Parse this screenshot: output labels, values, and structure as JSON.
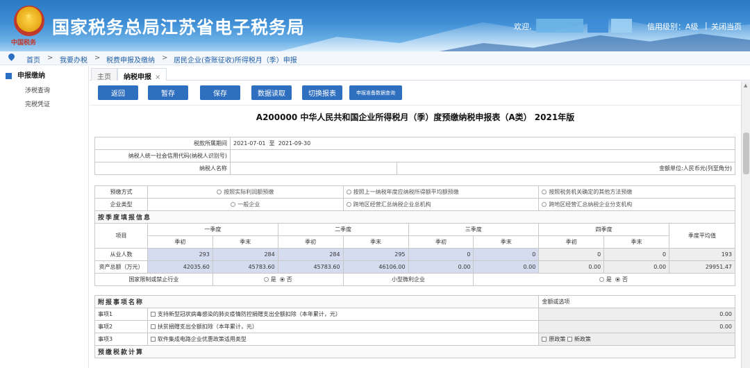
{
  "header": {
    "emblem_caption": "中国税务",
    "site_title": "国家税务总局江苏省电子税务局",
    "welcome": "欢迎,",
    "credit_level": "信用级别：A级",
    "close_label": "关闭当页"
  },
  "breadcrumb": [
    "首页",
    "我要办税",
    "税费申报及缴纳",
    "居民企业(查账征收)所得税月（季）申报"
  ],
  "sidebar": {
    "title": "申报缴纳",
    "items": [
      "涉税查询",
      "完税凭证"
    ]
  },
  "tabs": [
    {
      "label": "主页"
    },
    {
      "label": "纳税申报",
      "close": "×"
    }
  ],
  "toolbar": {
    "back": "返回",
    "draft": "暂存",
    "save": "保存",
    "read": "数据读取",
    "switch": "切换报表",
    "query": "申报准备数据查询"
  },
  "form": {
    "title": "A200000 中华人民共和国企业所得税月（季）度预缴纳税申报表（A类） 2021年版",
    "period_label": "税款所属期间",
    "period_start": "2021-07-01",
    "period_to": "至",
    "period_end": "2021-09-30",
    "taxid_label": "纳税人统一社会信用代码(纳税人识别号)",
    "name_label": "纳税人名称",
    "unit": "金额单位:人民币元(列至角分)",
    "prepay_label": "预缴方式",
    "prepay_options": [
      "按照实际利润额预缴",
      "按照上一纳税年度应纳税所得额平均额预缴",
      "按照税务机关确定的其他方法预缴"
    ],
    "enterprise_label": "企业类型",
    "enterprise_options": [
      "一般企业",
      "跨地区经营汇总纳税企业总机构",
      "跨地区经营汇总纳税企业分支机构"
    ],
    "quarter_section": "按季度填报信息",
    "item_col": "项目",
    "quarters": [
      "一季度",
      "二季度",
      "三季度",
      "四季度"
    ],
    "sub_start": "季初",
    "sub_end": "季末",
    "avg_col": "季度平均值",
    "employees_label": "从业人数",
    "employees": [
      "293",
      "284",
      "284",
      "295",
      "0",
      "0",
      "0",
      "0"
    ],
    "employees_avg": "193",
    "assets_label": "资产总额（万元）",
    "assets": [
      "42035.60",
      "45783.60",
      "45783.60",
      "46106.00",
      "0.00",
      "0.00",
      "0.00",
      "0.00"
    ],
    "assets_avg": "29951.47",
    "restricted_label": "国家限制或禁止行业",
    "small_label": "小型微利企业",
    "yes": "是",
    "no": "否",
    "attach_section": "附报事项名称",
    "amount_col": "金额或选项",
    "items": [
      {
        "label": "事项1",
        "text": "支持新型冠状病毒感染的肺炎疫情防控捐赠支出全额扣除（本年累计，元）",
        "value": "0.00"
      },
      {
        "label": "事项2",
        "text": "扶贫捐赠支出全额扣除（本年累计，元）",
        "value": "0.00"
      },
      {
        "label": "事项3",
        "text": "软件集成电路企业优惠政策适用类型",
        "opt1": "原政策",
        "opt2": "新政策"
      }
    ],
    "calc_section": "预缴税款计算"
  }
}
